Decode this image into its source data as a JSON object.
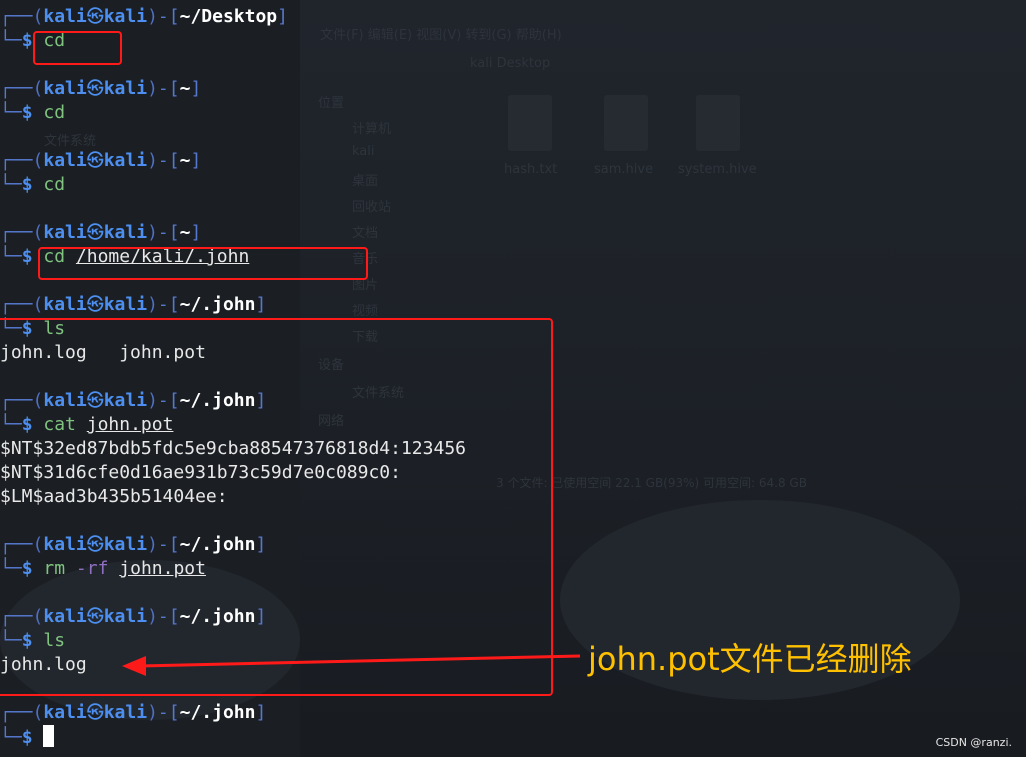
{
  "background_ghost": {
    "menu": "文件(F)   编辑(E)   视图(V)   转到(G)   帮助(H)",
    "location": "kali     Desktop",
    "places_header": "位置",
    "places": [
      "计算机",
      "kali",
      "桌面",
      "回收站",
      "文档",
      "音乐",
      "图片",
      "视频",
      "下载"
    ],
    "devices_header": "设备",
    "devices": [
      "文件系统"
    ],
    "network_header": "网络",
    "files": [
      "hash.txt",
      "sam.hive",
      "system.hive"
    ],
    "status": "3 个文件: 已使用空间 22.1 GB(93%)  可用空间: 64.8 GB",
    "left_ghost": "文件系统"
  },
  "terminal": {
    "user": "kali",
    "host": "kali",
    "symbol": "㉿",
    "blocks": [
      {
        "path": "~/Desktop",
        "cmd": "cd",
        "args": "",
        "flag": "",
        "output": []
      },
      {
        "path": "~",
        "cmd": "cd",
        "args": "",
        "flag": "",
        "output": []
      },
      {
        "path": "~",
        "cmd": "cd",
        "args": "",
        "flag": "",
        "output": []
      },
      {
        "path": "~",
        "cmd": "cd",
        "args": "/home/kali/.john",
        "flag": "",
        "output": []
      },
      {
        "path": "~/.john",
        "cmd": "ls",
        "args": "",
        "flag": "",
        "output": [
          "john.log   john.pot"
        ]
      },
      {
        "path": "~/.john",
        "cmd": "cat",
        "args": "john.pot",
        "flag": "",
        "output": [
          "$NT$32ed87bdb5fdc5e9cba88547376818d4:123456",
          "$NT$31d6cfe0d16ae931b73c59d7e0c089c0:",
          "$LM$aad3b435b51404ee:"
        ]
      },
      {
        "path": "~/.john",
        "cmd": "rm",
        "args": "john.pot",
        "flag": "-rf",
        "output": []
      },
      {
        "path": "~/.john",
        "cmd": "ls",
        "args": "",
        "flag": "",
        "output": [
          "john.log"
        ]
      },
      {
        "path": "~/.john",
        "cmd": "",
        "args": "",
        "flag": "",
        "output": [],
        "cursor": true
      }
    ]
  },
  "annotation": {
    "text": "john.pot文件已经删除",
    "color": "#ffc000",
    "highlight_color": "#ff1a1a"
  },
  "watermark": "CSDN @ranzi."
}
